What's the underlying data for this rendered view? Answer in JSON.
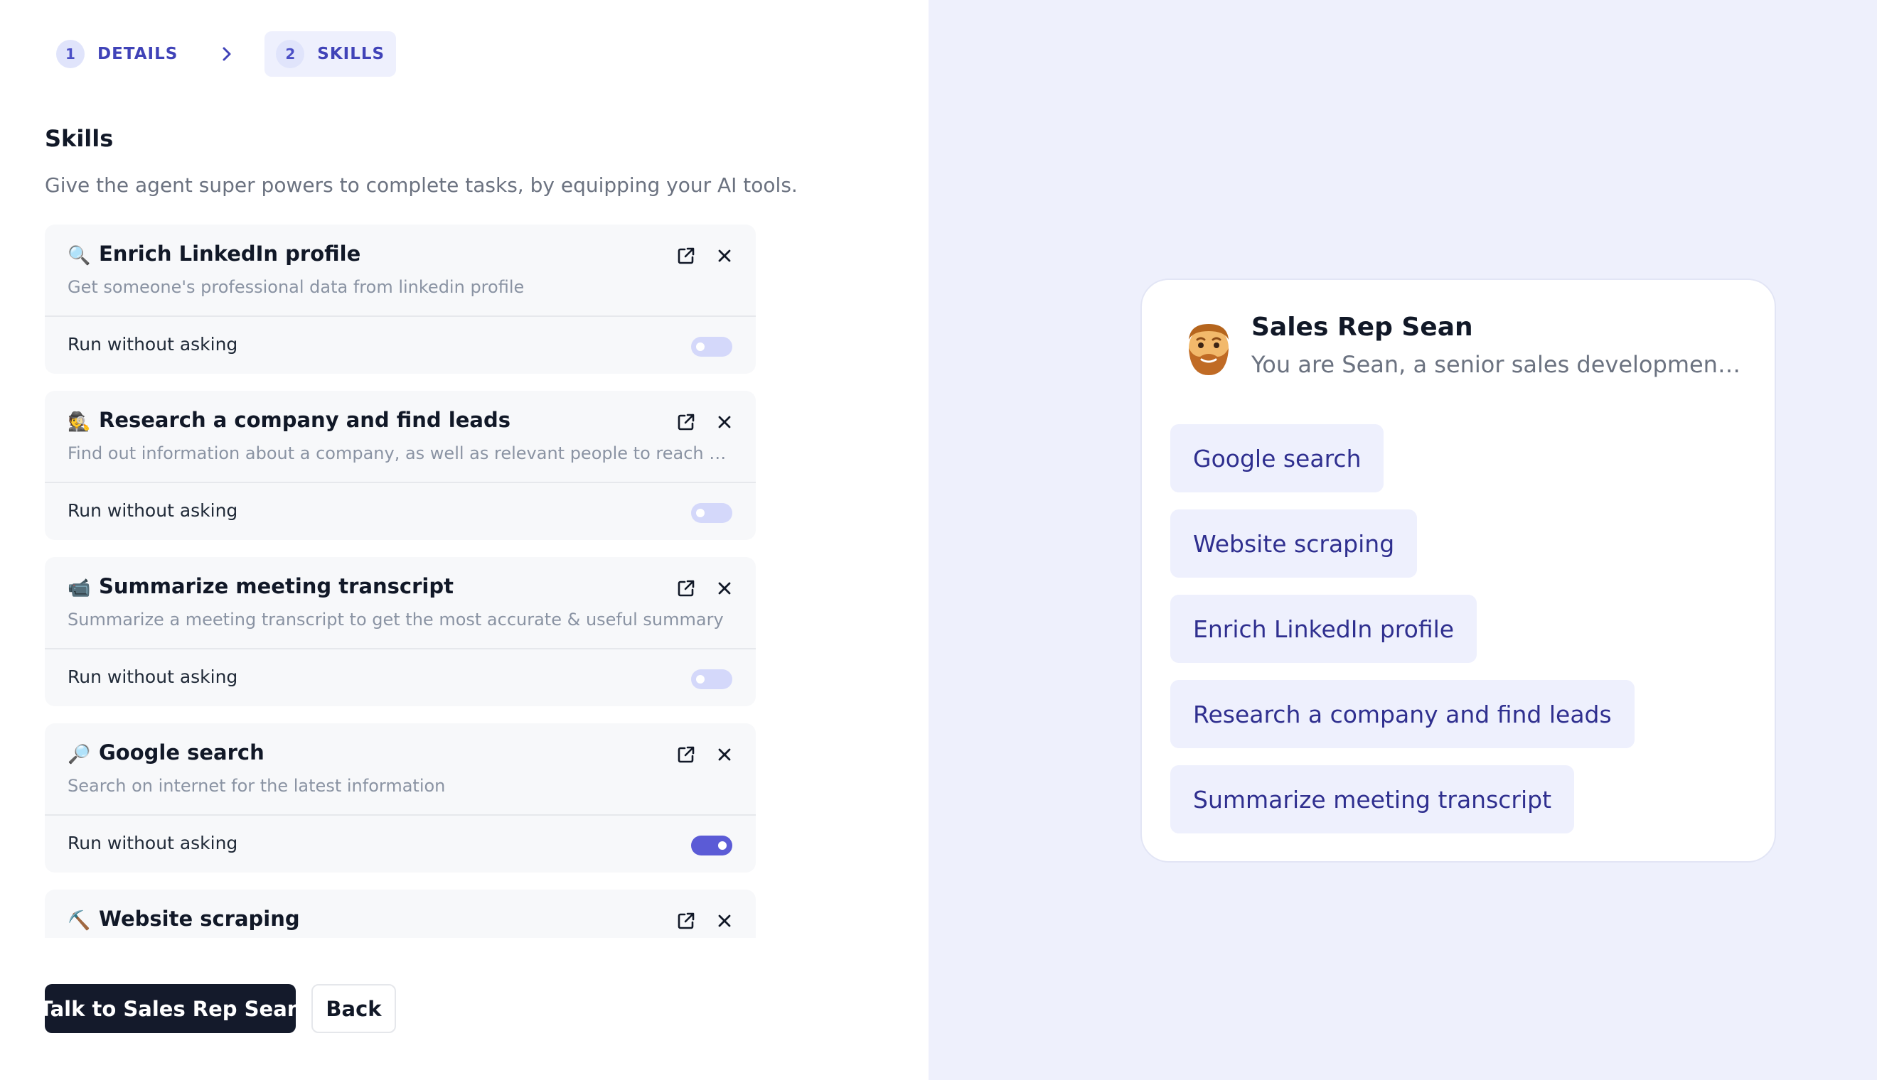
{
  "stepper": {
    "steps": [
      {
        "number": "1",
        "label": "DETAILS"
      },
      {
        "number": "2",
        "label": "SKILLS"
      }
    ],
    "separator_icon": "chevron-right-icon"
  },
  "skills_section": {
    "heading": "Skills",
    "subheading": "Give the agent super powers to complete tasks, by equipping your AI tools."
  },
  "skills": [
    {
      "emoji": "🔍",
      "title": "Enrich LinkedIn profile",
      "description": "Get someone's professional data from linkedin profile",
      "run_label": "Run without asking",
      "run_without_asking": false
    },
    {
      "emoji": "🕵️",
      "title": "Research a company and find leads",
      "description": "Find out information about a company, as well as relevant people to reach out to",
      "run_label": "Run without asking",
      "run_without_asking": false
    },
    {
      "emoji": "📹",
      "title": "Summarize meeting transcript",
      "description": "Summarize a meeting transcript to get the most accurate & useful summary",
      "run_label": "Run without asking",
      "run_without_asking": false
    },
    {
      "emoji": "🔎",
      "title": "Google search",
      "description": "Search on internet for the latest information",
      "run_label": "Run without asking",
      "run_without_asking": true
    },
    {
      "emoji": "⛏️",
      "title": "Website scraping",
      "description": "",
      "run_label": "",
      "run_without_asking": false
    }
  ],
  "actions": {
    "primary_label": "Talk to Sales Rep Sean",
    "secondary_label": "Back"
  },
  "agent_preview": {
    "avatar_emoji": "🧔",
    "name": "Sales Rep Sean",
    "description": "You are Sean, a senior sales development representative",
    "skill_chips": [
      "Google search",
      "Website scraping",
      "Enrich LinkedIn profile",
      "Research a company and find leads",
      "Summarize meeting transcript"
    ]
  },
  "colors": {
    "accent": "#5b5bd6",
    "primary_button": "#141a2b",
    "right_panel_bg": "#eef0fc",
    "chip_bg": "#eef0fd",
    "chip_text": "#2f2f8f"
  }
}
